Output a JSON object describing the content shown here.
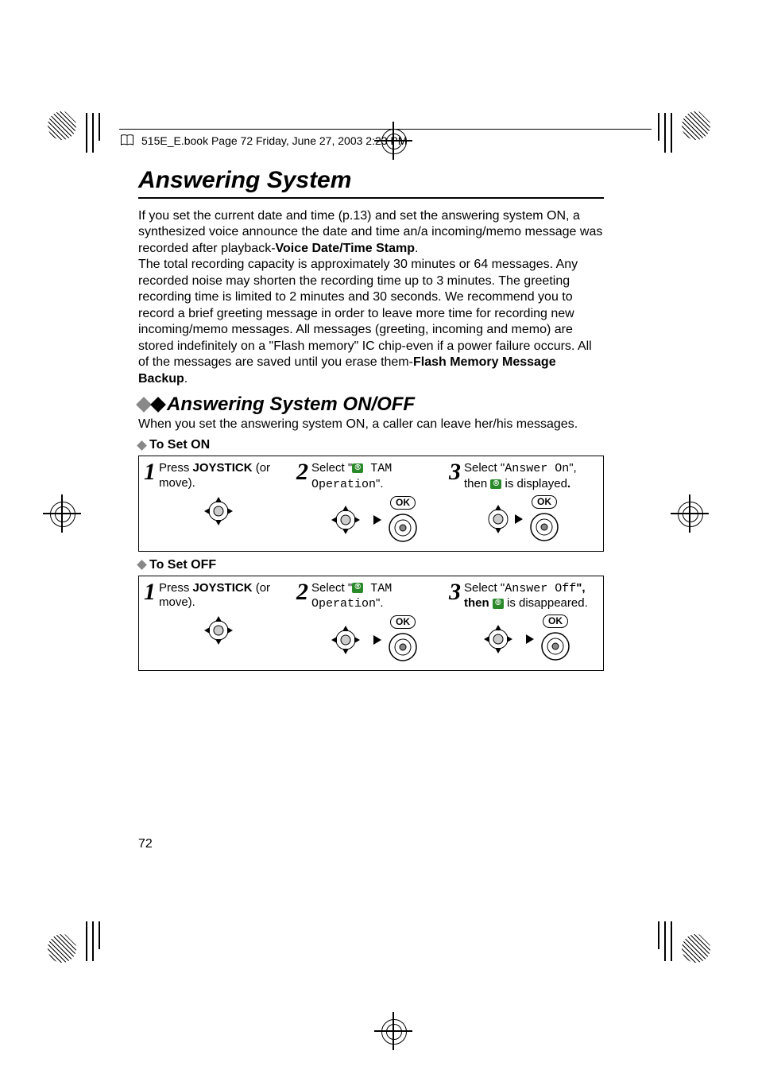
{
  "header_line": "515E_E.book  Page 72  Friday, June 27, 2003  2:23 PM",
  "title": "Answering System",
  "intro_1a": "If you set the current date and time (p.13) and set the answering system ON, a synthesized voice announce the date and time an/a incoming/memo message was recorded after playback-",
  "intro_1b": "Voice Date/Time Stamp",
  "intro_1c": ".",
  "intro_2a": "The total recording capacity is approximately 30 minutes or 64 messages. Any recorded noise may shorten the recording time up to 3 minutes. The greeting recording time is limited to 2 minutes and 30 seconds. We recommend you to record a brief greeting message in order to leave more time for recording new incoming/memo messages. All messages (greeting, incoming and memo) are stored indefinitely on a \"Flash memory\" IC chip-even if a power failure occurs. All of the messages are saved until you erase them-",
  "intro_2b": "Flash Memory Message Backup",
  "intro_2c": ".",
  "section": "Answering System ON/OFF",
  "section_caption": "When you set the answering system ON, a caller can leave her/his messages.",
  "to_set_on": "To Set ON",
  "to_set_off": "To Set OFF",
  "steps_on": {
    "step1_a": "Press ",
    "step1_b": "JOYSTICK",
    "step1_c": " (or move).",
    "step2_a": "Select \"",
    "step2_b": " TAM Operation",
    "step2_c": "\".",
    "step3_a": "Select \"",
    "step3_b": "Answer On",
    "step3_c": "\", then ",
    "step3_d": " is displayed",
    "step3_e": "."
  },
  "steps_off": {
    "step1_a": "Press ",
    "step1_b": "JOYSTICK",
    "step1_c": " (or move).",
    "step2_a": "Select \"",
    "step2_b": " TAM Operation",
    "step2_c": "\".",
    "step3_a": "Select \"",
    "step3_b": "Answer Off",
    "step3_c": "\", then ",
    "step3_d": " is disappeared.",
    "step3_e": ""
  },
  "ok_label": "OK",
  "page_number": "72"
}
